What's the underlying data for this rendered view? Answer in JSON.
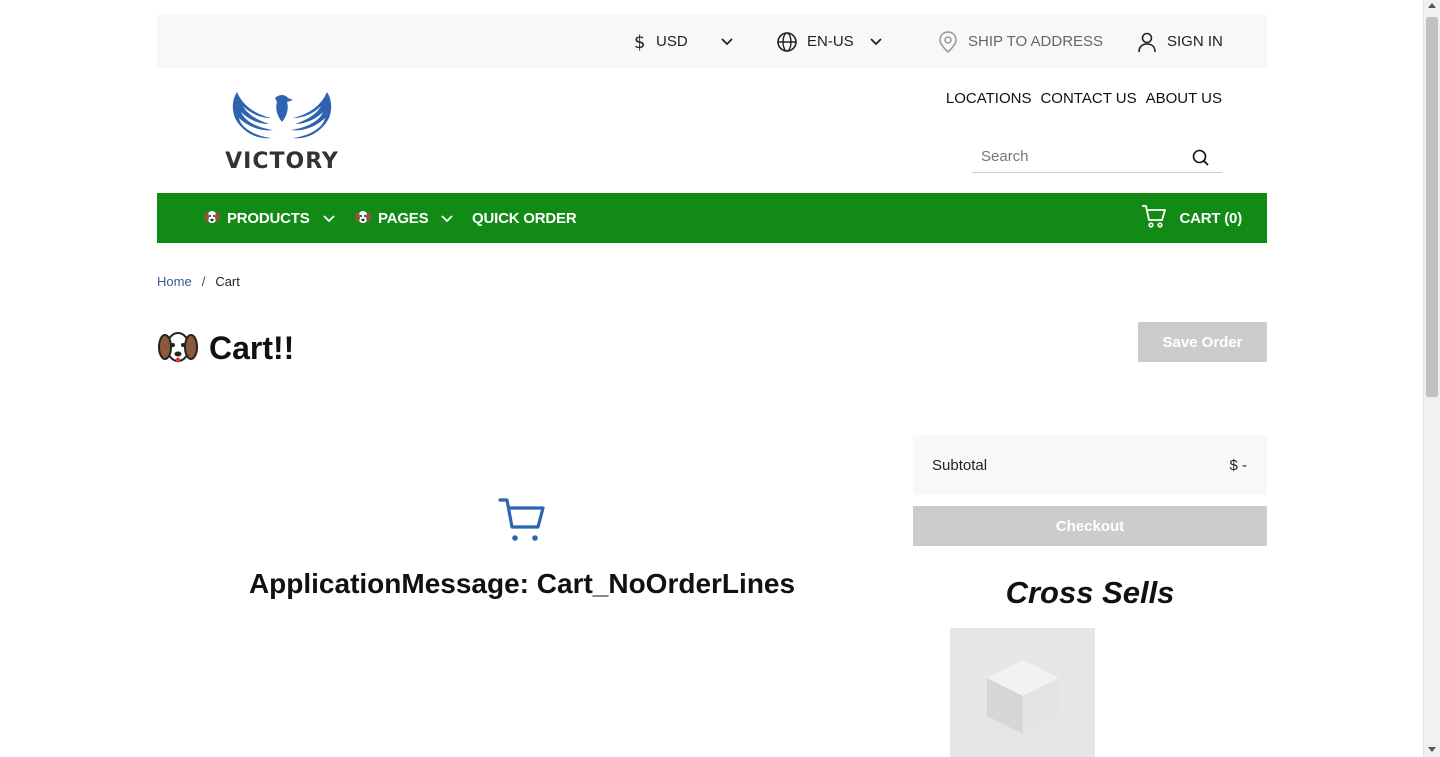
{
  "utility_bar": {
    "currency": "USD",
    "language": "EN-US",
    "ship_to": "SHIP TO ADDRESS",
    "sign_in": "SIGN IN"
  },
  "header": {
    "logo_text": "VICTORY",
    "links": [
      "LOCATIONS",
      "CONTACT US",
      "ABOUT US"
    ],
    "search_placeholder": "Search"
  },
  "nav": {
    "products": "PRODUCTS",
    "pages": "PAGES",
    "quick_order": "QUICK ORDER",
    "cart": "CART (0)",
    "background": "#128a16"
  },
  "breadcrumb": {
    "home": "Home",
    "separator": "/",
    "current": "Cart"
  },
  "page": {
    "title": "Cart!!",
    "save_order": "Save Order"
  },
  "cart": {
    "empty_message": "ApplicationMessage: Cart_NoOrderLines",
    "subtotal_label": "Subtotal",
    "subtotal_value": "$ -",
    "checkout": "Checkout",
    "cross_sells_title": "Cross Sells"
  },
  "colors": {
    "accent_blue": "#2e63b0",
    "disabled_button": "#cccccc"
  }
}
